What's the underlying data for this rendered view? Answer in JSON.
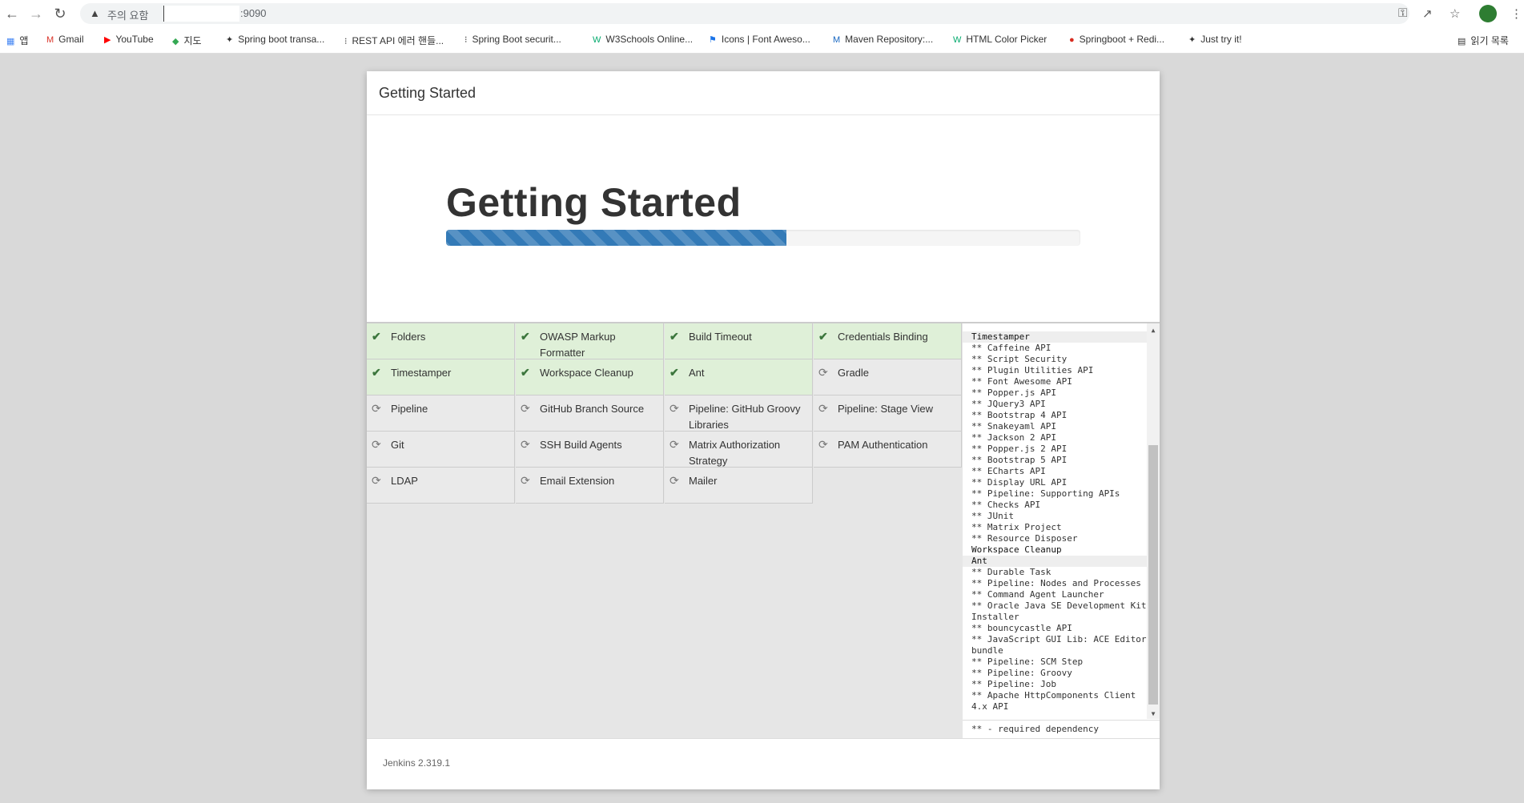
{
  "browser": {
    "address_warning": "주의 요함",
    "address_port": ":9090",
    "bookmarks": [
      {
        "label": "앱",
        "icon": "apps-grid-icon"
      },
      {
        "label": "Gmail",
        "icon": "gmail-icon"
      },
      {
        "label": "YouTube",
        "icon": "youtube-icon"
      },
      {
        "label": "지도",
        "icon": "maps-icon"
      },
      {
        "label": "Spring boot transa...",
        "icon": "leaf-icon"
      },
      {
        "label": "REST API 에러 핸들...",
        "icon": "dots-icon"
      },
      {
        "label": "Spring Boot securit...",
        "icon": "dots-icon"
      },
      {
        "label": "W3Schools Online...",
        "icon": "w3schools-icon"
      },
      {
        "label": "Icons | Font Aweso...",
        "icon": "flag-icon"
      },
      {
        "label": "Maven Repository:...",
        "icon": "maven-icon"
      },
      {
        "label": "HTML Color Picker",
        "icon": "w3schools-icon"
      },
      {
        "label": "Springboot + Redi...",
        "icon": "redis-icon"
      },
      {
        "label": "Just try it!",
        "icon": "leaf-icon"
      }
    ],
    "reading_list": "읽기 목록"
  },
  "dialog": {
    "header_title": "Getting Started",
    "hero_title": "Getting Started",
    "progress_fraction": 0.536,
    "version": "Jenkins 2.319.1"
  },
  "plugins": [
    {
      "name": "Folders",
      "status": "done"
    },
    {
      "name": "OWASP Markup Formatter",
      "status": "done"
    },
    {
      "name": "Build Timeout",
      "status": "done"
    },
    {
      "name": "Credentials Binding",
      "status": "done"
    },
    {
      "name": "Timestamper",
      "status": "done"
    },
    {
      "name": "Workspace Cleanup",
      "status": "done"
    },
    {
      "name": "Ant",
      "status": "done"
    },
    {
      "name": "Gradle",
      "status": "pending"
    },
    {
      "name": "Pipeline",
      "status": "pending"
    },
    {
      "name": "GitHub Branch Source",
      "status": "pending"
    },
    {
      "name": "Pipeline: GitHub Groovy Libraries",
      "status": "pending"
    },
    {
      "name": "Pipeline: Stage View",
      "status": "pending"
    },
    {
      "name": "Git",
      "status": "pending"
    },
    {
      "name": "SSH Build Agents",
      "status": "pending"
    },
    {
      "name": "Matrix Authorization Strategy",
      "status": "pending"
    },
    {
      "name": "PAM Authentication",
      "status": "pending"
    },
    {
      "name": "LDAP",
      "status": "pending"
    },
    {
      "name": "Email Extension",
      "status": "pending"
    },
    {
      "name": "Mailer",
      "status": "pending"
    }
  ],
  "install_log": [
    {
      "text": "Timestamper",
      "kind": "plugin"
    },
    {
      "text": "** Caffeine API",
      "kind": "dep"
    },
    {
      "text": "** Script Security",
      "kind": "dep"
    },
    {
      "text": "** Plugin Utilities API",
      "kind": "dep"
    },
    {
      "text": "** Font Awesome API",
      "kind": "dep"
    },
    {
      "text": "** Popper.js API",
      "kind": "dep"
    },
    {
      "text": "** JQuery3 API",
      "kind": "dep"
    },
    {
      "text": "** Bootstrap 4 API",
      "kind": "dep"
    },
    {
      "text": "** Snakeyaml API",
      "kind": "dep"
    },
    {
      "text": "** Jackson 2 API",
      "kind": "dep"
    },
    {
      "text": "** Popper.js 2 API",
      "kind": "dep"
    },
    {
      "text": "** Bootstrap 5 API",
      "kind": "dep"
    },
    {
      "text": "** ECharts API",
      "kind": "dep"
    },
    {
      "text": "** Display URL API",
      "kind": "dep"
    },
    {
      "text": "** Pipeline: Supporting APIs",
      "kind": "dep"
    },
    {
      "text": "** Checks API",
      "kind": "dep"
    },
    {
      "text": "** JUnit",
      "kind": "dep"
    },
    {
      "text": "** Matrix Project",
      "kind": "dep"
    },
    {
      "text": "** Resource Disposer",
      "kind": "dep"
    },
    {
      "text": "Workspace Cleanup",
      "kind": "plugin"
    },
    {
      "text": "Ant",
      "kind": "plugin"
    },
    {
      "text": "** Durable Task",
      "kind": "dep"
    },
    {
      "text": "** Pipeline: Nodes and Processes",
      "kind": "dep"
    },
    {
      "text": "** Command Agent Launcher",
      "kind": "dep"
    },
    {
      "text": "** Oracle Java SE Development Kit Installer",
      "kind": "dep"
    },
    {
      "text": "** bouncycastle API",
      "kind": "dep"
    },
    {
      "text": "** JavaScript GUI Lib: ACE Editor bundle",
      "kind": "dep"
    },
    {
      "text": "** Pipeline: SCM Step",
      "kind": "dep"
    },
    {
      "text": "** Pipeline: Groovy",
      "kind": "dep"
    },
    {
      "text": "** Pipeline: Job",
      "kind": "dep"
    },
    {
      "text": "** Apache HttpComponents Client 4.x API",
      "kind": "dep"
    }
  ],
  "log_footer": "** - required dependency"
}
